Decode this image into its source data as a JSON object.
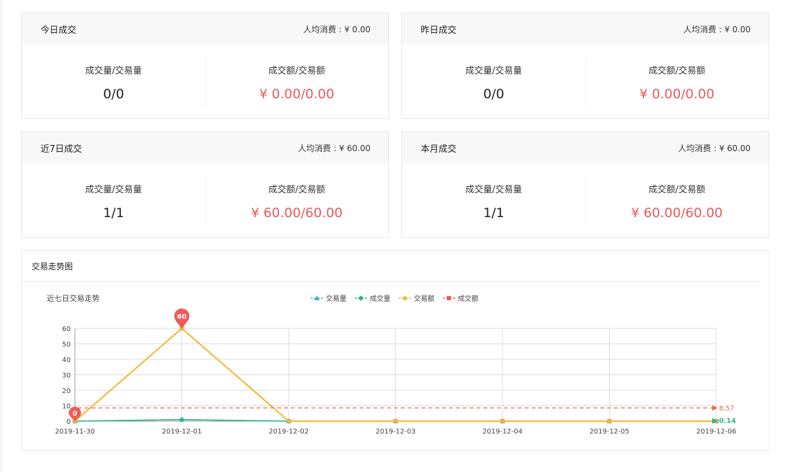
{
  "cards": [
    {
      "title": "今日成交",
      "avg": "人均消费 : ¥ 0.00",
      "left_label": "成交量/交易量",
      "left_value": "0/0",
      "right_label": "成交额/交易额",
      "right_value": "¥ 0.00/0.00"
    },
    {
      "title": "昨日成交",
      "avg": "人均消费 : ¥ 0.00",
      "left_label": "成交量/交易量",
      "left_value": "0/0",
      "right_label": "成交额/交易额",
      "right_value": "¥ 0.00/0.00"
    },
    {
      "title": "近7日成交",
      "avg": "人均消费 : ¥ 60.00",
      "left_label": "成交量/交易量",
      "left_value": "1/1",
      "right_label": "成交额/交易额",
      "right_value": "¥ 60.00/60.00"
    },
    {
      "title": "本月成交",
      "avg": "人均消费 : ¥ 60.00",
      "left_label": "成交量/交易量",
      "left_value": "1/1",
      "right_label": "成交额/交易额",
      "right_value": "¥ 60.00/60.00"
    }
  ],
  "chart_panel": {
    "title": "交易走势图"
  },
  "chart_data": {
    "type": "line",
    "title": "近七日交易走势",
    "x": [
      "2019-11-30",
      "2019-12-01",
      "2019-12-02",
      "2019-12-03",
      "2019-12-04",
      "2019-12-05",
      "2019-12-06"
    ],
    "ylim": [
      0,
      60
    ],
    "yticks": [
      0,
      10,
      20,
      30,
      40,
      50,
      60
    ],
    "legend_position": "top-center",
    "grid": true,
    "series": [
      {
        "name": "交易量",
        "color": "#4aa7d6",
        "marker": "triangle",
        "values": [
          0,
          1,
          0,
          0,
          0,
          0,
          0
        ]
      },
      {
        "name": "成交量",
        "color": "#2fb38a",
        "marker": "diamond",
        "values": [
          0,
          1,
          0,
          0,
          0,
          0,
          0
        ]
      },
      {
        "name": "交易额",
        "color": "#f5b731",
        "marker": "circle",
        "values": [
          0,
          60,
          0,
          0,
          0,
          0,
          0
        ]
      },
      {
        "name": "成交额",
        "color": "#ef5b5b",
        "marker": "square",
        "values": [
          0,
          60,
          0,
          0,
          0,
          0,
          0
        ]
      }
    ],
    "annotations": {
      "max_label": "60",
      "min_label": "0",
      "avg_line": {
        "value": 8.57,
        "label": "8.57",
        "color": "#f06a4a"
      },
      "avg_line_small": {
        "value": 0.14,
        "label": "0.14",
        "color": "#2fb38a"
      }
    }
  }
}
